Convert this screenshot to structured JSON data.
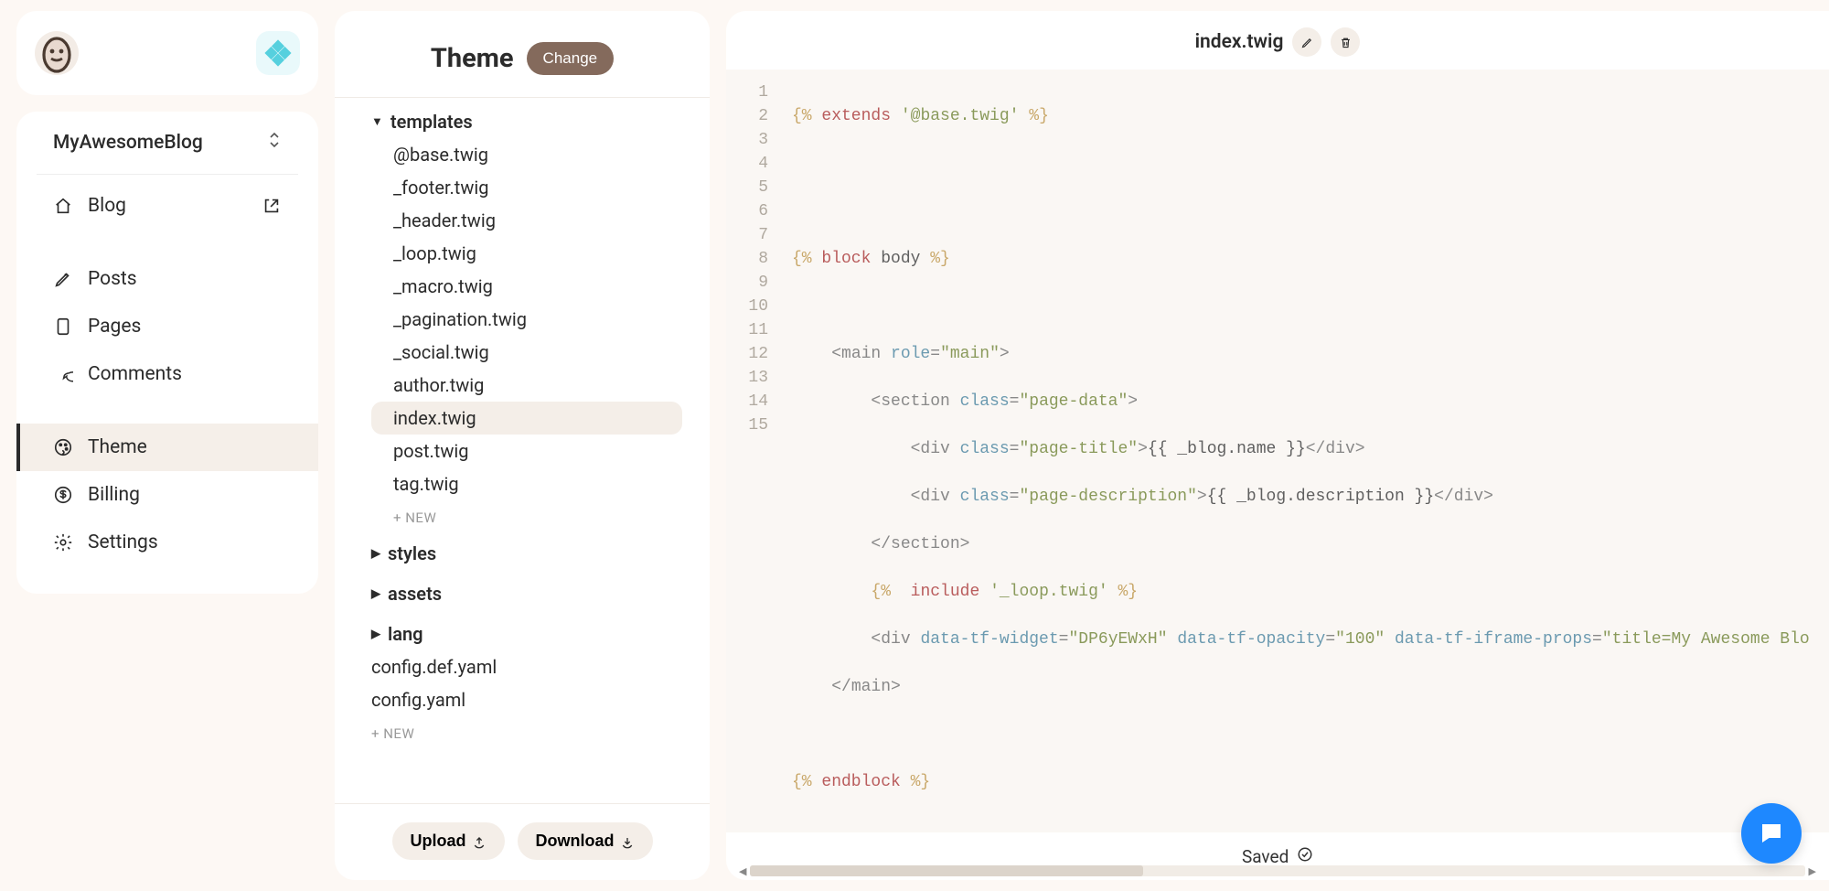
{
  "sidebar": {
    "blog_name": "MyAwesomeBlog",
    "items": [
      {
        "id": "blog",
        "label": "Blog",
        "external": true
      },
      {
        "id": "posts",
        "label": "Posts"
      },
      {
        "id": "pages",
        "label": "Pages"
      },
      {
        "id": "comments",
        "label": "Comments"
      },
      {
        "id": "theme",
        "label": "Theme",
        "active": true
      },
      {
        "id": "billing",
        "label": "Billing"
      },
      {
        "id": "settings",
        "label": "Settings"
      }
    ]
  },
  "filepanel": {
    "title": "Theme",
    "change_label": "Change",
    "folders": {
      "templates": {
        "label": "templates",
        "expanded": true,
        "files": [
          "@base.twig",
          "_footer.twig",
          "_header.twig",
          "_loop.twig",
          "_macro.twig",
          "_pagination.twig",
          "_social.twig",
          "author.twig",
          "index.twig",
          "post.twig",
          "tag.twig"
        ],
        "selected": "index.twig",
        "new_label": "+  NEW"
      },
      "styles": {
        "label": "styles",
        "expanded": false
      },
      "assets": {
        "label": "assets",
        "expanded": false
      },
      "lang": {
        "label": "lang",
        "expanded": false
      }
    },
    "root_files": [
      "config.def.yaml",
      "config.yaml"
    ],
    "new_label": "+  NEW",
    "upload_label": "Upload",
    "download_label": "Download"
  },
  "editor": {
    "filename": "index.twig",
    "saved_label": "Saved",
    "code": {
      "lines": 15,
      "l1_d1": "{% ",
      "l1_kw": "extends",
      "l1_sp": " ",
      "l1_str": "'@base.twig'",
      "l1_d2": " %}",
      "l4_d1": "{% ",
      "l4_kw": "block",
      "l4_sp": " body ",
      "l4_d2": "%}",
      "l6_ind": "    ",
      "l6_t1": "<main ",
      "l6_a1": "role",
      "l6_eq": "=",
      "l6_s1": "\"main\"",
      "l6_t2": ">",
      "l7_ind": "        ",
      "l7_t1": "<section ",
      "l7_a1": "class",
      "l7_eq": "=",
      "l7_s1": "\"page-data\"",
      "l7_t2": ">",
      "l8_ind": "            ",
      "l8_t1": "<div ",
      "l8_a1": "class",
      "l8_eq": "=",
      "l8_s1": "\"page-title\"",
      "l8_t2": ">",
      "l8_exp": "{{ _blog.name }}",
      "l8_t3": "</div>",
      "l9_ind": "            ",
      "l9_t1": "<div ",
      "l9_a1": "class",
      "l9_eq": "=",
      "l9_s1": "\"page-description\"",
      "l9_t2": ">",
      "l9_exp": "{{ _blog.description }}",
      "l9_t3": "</div>",
      "l10_ind": "        ",
      "l10_t": "</section>",
      "l11_ind": "        ",
      "l11_d1": "{%  ",
      "l11_kw": "include",
      "l11_sp": " ",
      "l11_str": "'_loop.twig'",
      "l11_d2": " %}",
      "l12_ind": "        ",
      "l12_t1": "<div ",
      "l12_a1": "data-tf-widget",
      "l12_eq1": "=",
      "l12_s1": "\"DP6yEWxH\"",
      "l12_sp1": " ",
      "l12_a2": "data-tf-opacity",
      "l12_eq2": "=",
      "l12_s2": "\"100\"",
      "l12_sp2": " ",
      "l12_a3": "data-tf-iframe-props",
      "l12_eq3": "=",
      "l12_s3": "\"title=My Awesome Blo",
      "l13_ind": "    ",
      "l13_t": "</main>",
      "l15_d1": "{% ",
      "l15_kw": "endblock",
      "l15_d2": " %}"
    }
  }
}
